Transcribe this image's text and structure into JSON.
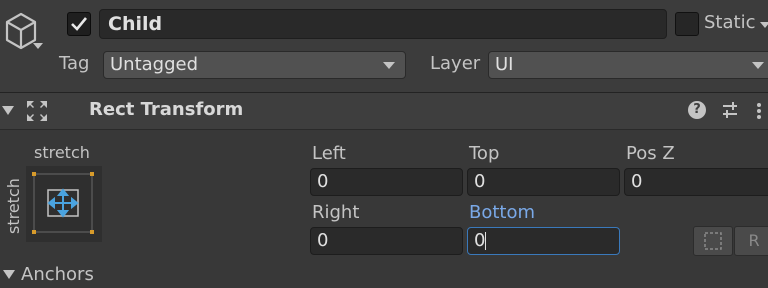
{
  "object": {
    "name": "Child",
    "active": true,
    "static_label": "Static",
    "tag_label": "Tag",
    "tag_value": "Untagged",
    "layer_label": "Layer",
    "layer_value": "UI"
  },
  "component": {
    "title": "Rect Transform",
    "anchor_h": "stretch",
    "anchor_v": "stretch",
    "fields": {
      "left": {
        "label": "Left",
        "value": "0"
      },
      "top": {
        "label": "Top",
        "value": "0"
      },
      "posz": {
        "label": "Pos Z",
        "value": "0"
      },
      "right": {
        "label": "Right",
        "value": "0"
      },
      "bottom": {
        "label": "Bottom",
        "value": "0"
      }
    },
    "raw_button_label": "R"
  },
  "anchors": {
    "label": "Anchors"
  },
  "colors": {
    "background": "#383838",
    "field_bg": "#2a2a2a",
    "focus_border": "#3a79bb",
    "focus_label": "#7aa9e8",
    "anchor_orange": "#d79b2b",
    "gizmo_blue": "#4aa3df"
  }
}
